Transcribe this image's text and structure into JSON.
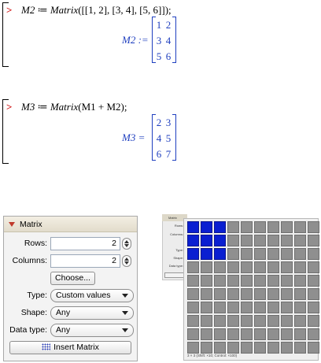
{
  "worksheet": {
    "groups": [
      {
        "prompt": ">",
        "input_name": "M2",
        "input_assign": " ≔ ",
        "input_func": "Matrix",
        "input_args": "([[1, 2], [3, 4], [5, 6]]);",
        "output_label": "M2 :=",
        "matrix": [
          [
            "1",
            "2"
          ],
          [
            "3",
            "4"
          ],
          [
            "5",
            "6"
          ]
        ]
      },
      {
        "prompt": ">",
        "input_name": "M3",
        "input_assign": " ≔ ",
        "input_func": "Matrix",
        "input_args": "(M1 + M2);",
        "output_label": "M3 =",
        "matrix": [
          [
            "2",
            "3"
          ],
          [
            "4",
            "5"
          ],
          [
            "6",
            "7"
          ]
        ]
      }
    ]
  },
  "palette": {
    "title": "Matrix",
    "rows_label": "Rows:",
    "rows_value": "2",
    "columns_label": "Columns:",
    "columns_value": "2",
    "choose_label": "Choose...",
    "type_label": "Type:",
    "type_value": "Custom values",
    "shape_label": "Shape:",
    "shape_value": "Any",
    "datatype_label": "Data type:",
    "datatype_value": "Any",
    "insert_label": "Insert Matrix"
  },
  "grid_chooser": {
    "mini_title": "Matrix",
    "mini_labels": [
      "Rows:",
      "Columns:",
      "Type:",
      "Shape:",
      "Data type:"
    ],
    "rows": 10,
    "cols": 10,
    "selected_rows": 3,
    "selected_cols": 3,
    "status": "3 × 3 (Shift: ×10; Control: ×100)"
  }
}
